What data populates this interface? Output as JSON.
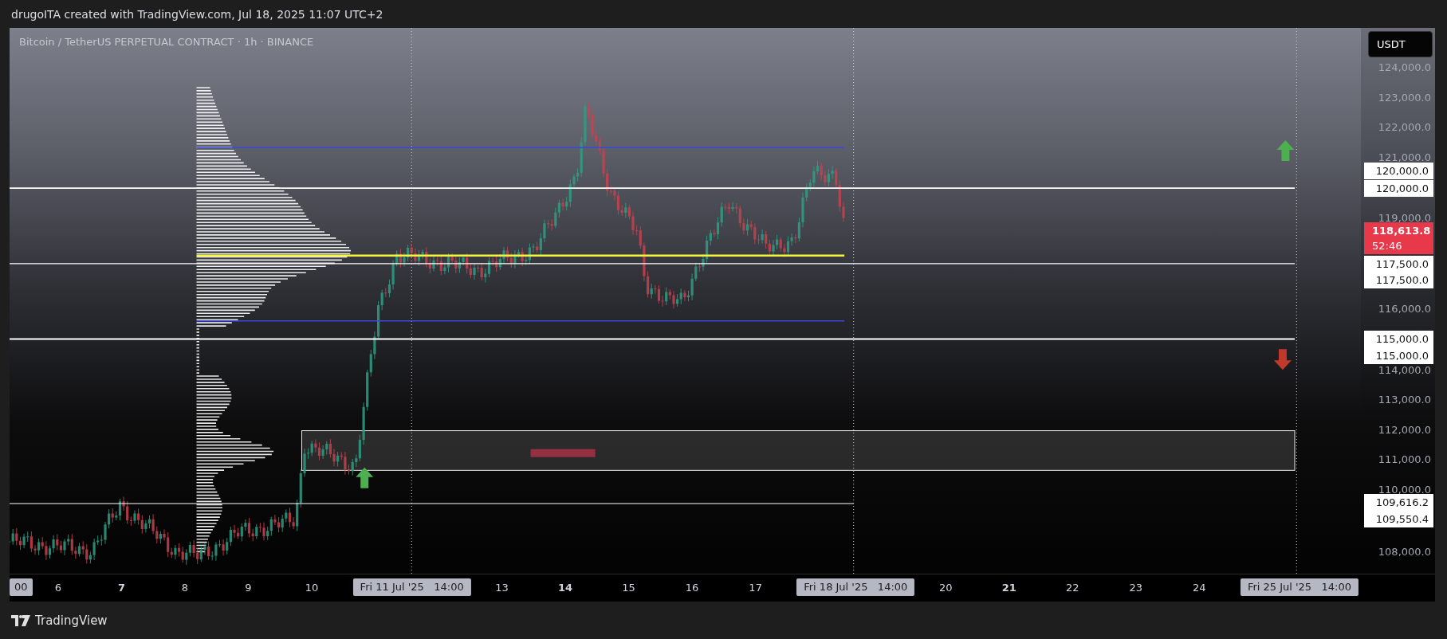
{
  "header": {
    "text": "drugoITA created with TradingView.com, Jul 18, 2025 11:07 UTC+2"
  },
  "chart": {
    "title": "Bitcoin / TetherUS PERPETUAL CONTRACT · 1h · BINANCE"
  },
  "price_axis": {
    "currency": "USDT",
    "labels": [
      {
        "kind": "tick",
        "text": "124,000.0"
      },
      {
        "kind": "tick",
        "text": "123,000.0"
      },
      {
        "kind": "tick",
        "text": "122,000.0"
      },
      {
        "kind": "tick",
        "text": "121,000.0"
      },
      {
        "kind": "level",
        "text": "120,000.0"
      },
      {
        "kind": "level",
        "text": "120,000.0"
      },
      {
        "kind": "tick",
        "text": "119,000.0"
      },
      {
        "kind": "last_price",
        "text": "118,613.8",
        "countdown": "52:46"
      },
      {
        "kind": "level",
        "text": "117,500.0"
      },
      {
        "kind": "level",
        "text": "117,500.0"
      },
      {
        "kind": "tick",
        "text": "116,000.0"
      },
      {
        "kind": "level",
        "text": "115,000.0"
      },
      {
        "kind": "level",
        "text": "115,000.0"
      },
      {
        "kind": "tick",
        "text": "114,000.0"
      },
      {
        "kind": "tick",
        "text": "113,000.0"
      },
      {
        "kind": "tick",
        "text": "112,000.0"
      },
      {
        "kind": "tick",
        "text": "111,000.0"
      },
      {
        "kind": "tick",
        "text": "110,000.0"
      },
      {
        "kind": "level",
        "text": "109,616.2"
      },
      {
        "kind": "level",
        "text": "109,550.4"
      },
      {
        "kind": "tick",
        "text": "108,000.0"
      }
    ]
  },
  "time_axis": {
    "labels": [
      {
        "kind": "highlight",
        "text": "00"
      },
      {
        "kind": "day",
        "text": "6"
      },
      {
        "kind": "week",
        "text": "7"
      },
      {
        "kind": "day",
        "text": "8"
      },
      {
        "kind": "day",
        "text": "9"
      },
      {
        "kind": "day",
        "text": "10"
      },
      {
        "kind": "highlight",
        "text": "Fri 11 Jul '25   14:00"
      },
      {
        "kind": "day",
        "text": "13"
      },
      {
        "kind": "week",
        "text": "14"
      },
      {
        "kind": "day",
        "text": "15"
      },
      {
        "kind": "day",
        "text": "16"
      },
      {
        "kind": "day",
        "text": "17"
      },
      {
        "kind": "highlight",
        "text": "Fri 18 Jul '25   14:00"
      },
      {
        "kind": "day",
        "text": "20"
      },
      {
        "kind": "week",
        "text": "21"
      },
      {
        "kind": "day",
        "text": "22"
      },
      {
        "kind": "day",
        "text": "23"
      },
      {
        "kind": "day",
        "text": "24"
      },
      {
        "kind": "highlight",
        "text": "Fri 25 Jul '25   14:00"
      }
    ]
  },
  "footer": {
    "logo_text": "TradingView"
  }
}
